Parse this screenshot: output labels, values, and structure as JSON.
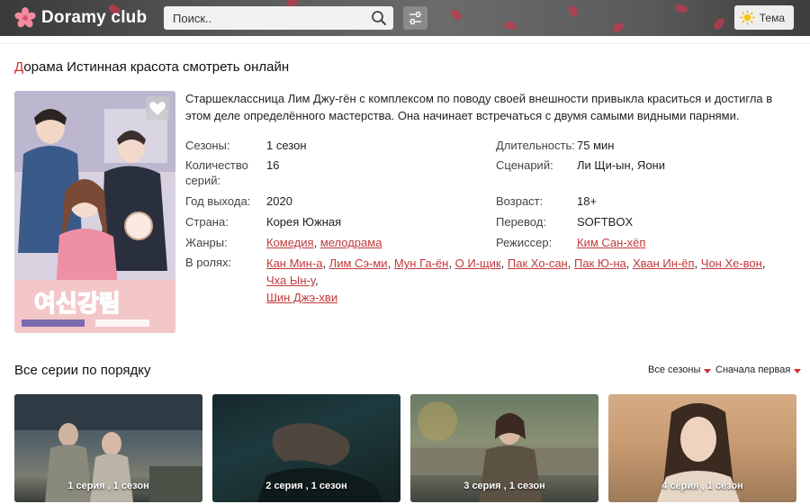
{
  "header": {
    "logo_text": "Doramy club",
    "search_placeholder": "Поиск..",
    "theme_label": "Тема"
  },
  "page": {
    "title_first": "Д",
    "title_rest": "орама Истинная красота смотреть онлайн",
    "description": "Старшеклассница Лим Джу-гён с комплексом по поводу своей внешности привыкла краситься и достигла в этом деле определённого мастерства. Она начинает встречаться с двумя самыми видными парнями."
  },
  "info": {
    "seasons_label": "Сезоны:",
    "seasons_value": "1 сезон",
    "episodes_label_1": "Количество",
    "episodes_label_2": "серий:",
    "episodes_value": "16",
    "year_label": "Год выхода:",
    "year_value": "2020",
    "country_label": "Страна:",
    "country_value": "Корея Южная",
    "genres_label": "Жанры:",
    "genres": [
      "Комедия",
      "мелодрама"
    ],
    "cast_label": "В ролях:",
    "cast": [
      "Кан Мин-а",
      "Лим Сэ-ми",
      "Мун Га-ён",
      "О И-щик",
      "Пак Хо-сан",
      "Пак Ю-на",
      "Хван Ин-ёп",
      "Чон Хе-вон",
      "Чха Ын-у",
      "Шин Джэ-хви"
    ],
    "duration_label": "Длительность:",
    "duration_value": "75 мин",
    "script_label": "Сценарий:",
    "script_value": "Ли Щи-ын, Яони",
    "age_label": "Возраст:",
    "age_value": "18+",
    "translation_label": "Перевод:",
    "translation_value": "SOFTBOX",
    "director_label": "Режиссер:",
    "director_value": "Ким Сан-хёп"
  },
  "episodes_section": {
    "title": "Все серии по порядку",
    "seasons_filter": "Все сезоны",
    "order_filter": "Сначала первая",
    "items": [
      {
        "label": "1 серия , 1 сезон"
      },
      {
        "label": "2 серия , 1 сезон"
      },
      {
        "label": "3 серия , 1 сезон"
      },
      {
        "label": "4 серия , 1 сезон"
      }
    ]
  },
  "colors": {
    "accent": "#d82c2c",
    "link": "#c0393b",
    "header_bg": "#5a5a5a"
  },
  "icons": [
    "sakura-logo-icon",
    "search-icon",
    "filter-icon",
    "sun-icon",
    "heart-icon",
    "caret-down-icon"
  ]
}
